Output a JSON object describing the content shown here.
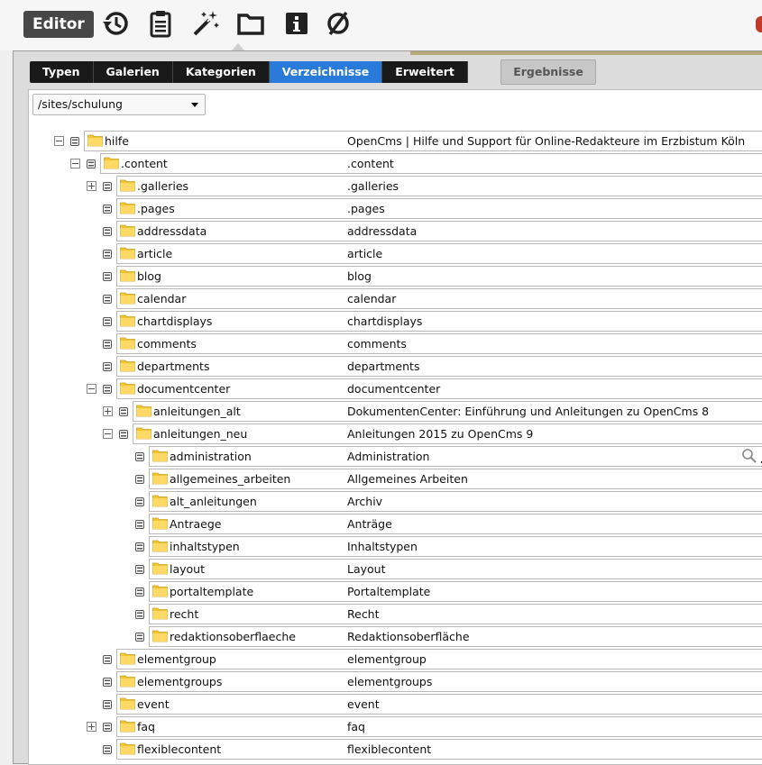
{
  "toolbar": {
    "editor_label": "Editor",
    "icons": [
      "history-icon",
      "clipboard-icon",
      "magic-wand-icon",
      "folder-icon",
      "info-icon",
      "empty-set-icon"
    ]
  },
  "tabs": [
    "Typen",
    "Galerien",
    "Kategorien",
    "Verzeichnisse",
    "Erweitert"
  ],
  "active_tab": "Verzeichnisse",
  "results_label": "Ergebnisse",
  "site_select": {
    "value": "/sites/schulung"
  },
  "colors": {
    "active_tab": "#2a7bd9",
    "folder": "#f4c430",
    "folder_tab": "#ffd966"
  },
  "tree": [
    {
      "name": "hilfe",
      "title": "OpenCms | Hilfe und Support für Online-Redakteure im Erzbistum Köln",
      "depth": 0,
      "toggle": "minus"
    },
    {
      "name": ".content",
      "title": ".content",
      "depth": 1,
      "toggle": "minus"
    },
    {
      "name": ".galleries",
      "title": ".galleries",
      "depth": 2,
      "toggle": "plus"
    },
    {
      "name": ".pages",
      "title": ".pages",
      "depth": 2,
      "toggle": ""
    },
    {
      "name": "addressdata",
      "title": "addressdata",
      "depth": 2,
      "toggle": ""
    },
    {
      "name": "article",
      "title": "article",
      "depth": 2,
      "toggle": ""
    },
    {
      "name": "blog",
      "title": "blog",
      "depth": 2,
      "toggle": ""
    },
    {
      "name": "calendar",
      "title": "calendar",
      "depth": 2,
      "toggle": ""
    },
    {
      "name": "chartdisplays",
      "title": "chartdisplays",
      "depth": 2,
      "toggle": ""
    },
    {
      "name": "comments",
      "title": "comments",
      "depth": 2,
      "toggle": ""
    },
    {
      "name": "departments",
      "title": "departments",
      "depth": 2,
      "toggle": ""
    },
    {
      "name": "documentcenter",
      "title": "documentcenter",
      "depth": 2,
      "toggle": "minus"
    },
    {
      "name": "anleitungen_alt",
      "title": "DokumentenCenter: Einführung und Anleitungen zu OpenCms 8",
      "depth": 3,
      "toggle": "plus"
    },
    {
      "name": "anleitungen_neu",
      "title": "Anleitungen 2015 zu OpenCms 9",
      "depth": 3,
      "toggle": "minus"
    },
    {
      "name": "administration",
      "title": "Administration",
      "depth": 4,
      "toggle": "",
      "actions": true
    },
    {
      "name": "allgemeines_arbeiten",
      "title": "Allgemeines Arbeiten",
      "depth": 4,
      "toggle": ""
    },
    {
      "name": "alt_anleitungen",
      "title": "Archiv",
      "depth": 4,
      "toggle": ""
    },
    {
      "name": "Antraege",
      "title": "Anträge",
      "depth": 4,
      "toggle": ""
    },
    {
      "name": "inhaltstypen",
      "title": "Inhaltstypen",
      "depth": 4,
      "toggle": ""
    },
    {
      "name": "layout",
      "title": "Layout",
      "depth": 4,
      "toggle": ""
    },
    {
      "name": "portaltemplate",
      "title": "Portaltemplate",
      "depth": 4,
      "toggle": ""
    },
    {
      "name": "recht",
      "title": "Recht",
      "depth": 4,
      "toggle": ""
    },
    {
      "name": "redaktionsoberflaeche",
      "title": "Redaktionsoberfläche",
      "depth": 4,
      "toggle": ""
    },
    {
      "name": "elementgroup",
      "title": "elementgroup",
      "depth": 2,
      "toggle": ""
    },
    {
      "name": "elementgroups",
      "title": "elementgroups",
      "depth": 2,
      "toggle": ""
    },
    {
      "name": "event",
      "title": "event",
      "depth": 2,
      "toggle": ""
    },
    {
      "name": "faq",
      "title": "faq",
      "depth": 2,
      "toggle": "plus"
    },
    {
      "name": "flexiblecontent",
      "title": "flexiblecontent",
      "depth": 2,
      "toggle": ""
    }
  ]
}
